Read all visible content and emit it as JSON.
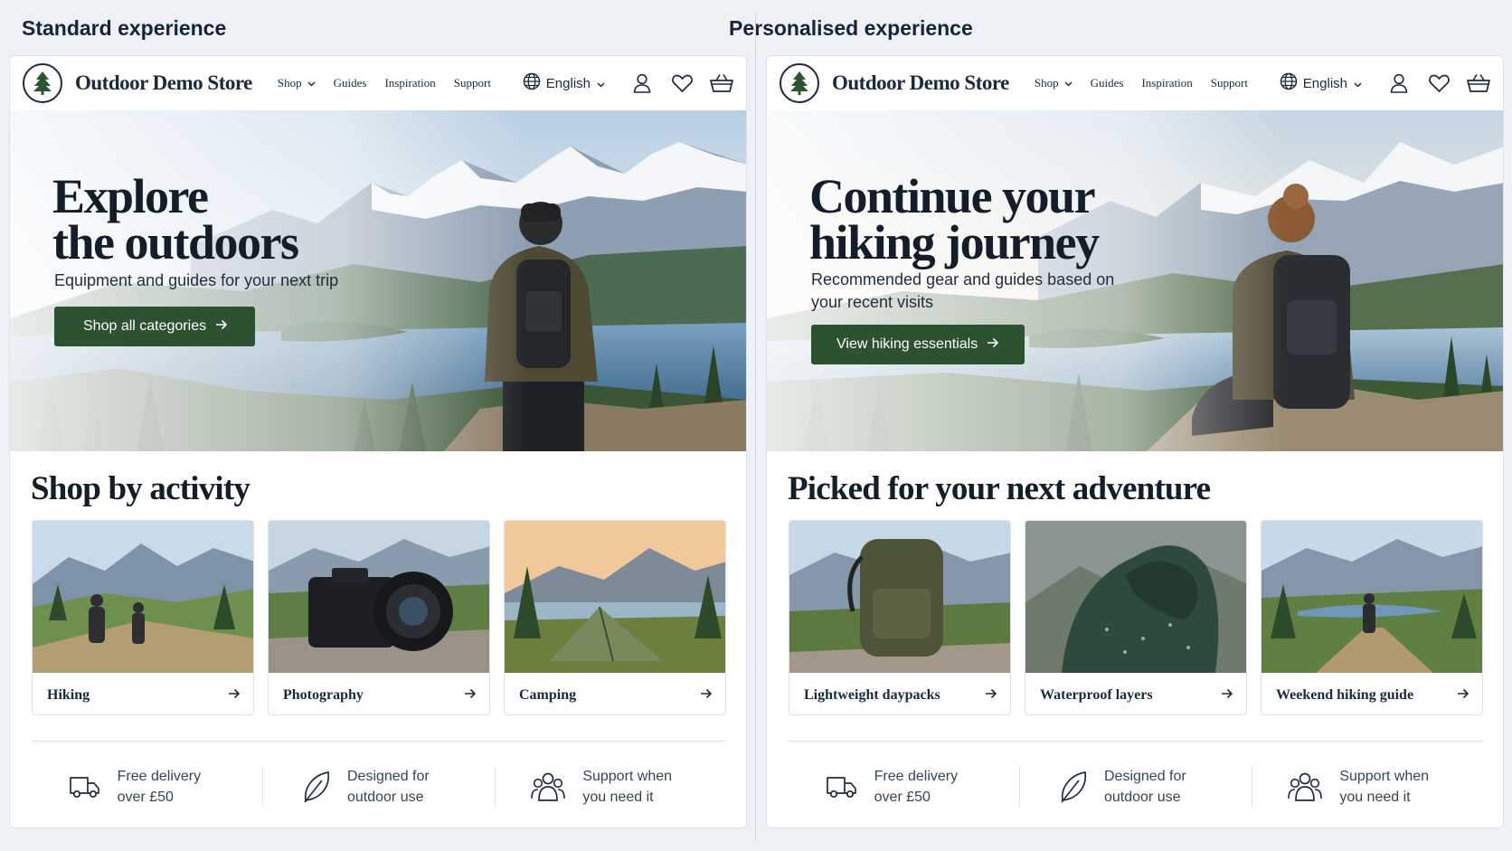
{
  "columns": {
    "left_title": "Standard experience",
    "right_title": "Personalised experience"
  },
  "header": {
    "store_name": "Outdoor Demo Store",
    "nav": [
      "Shop",
      "Guides",
      "Inspiration",
      "Support"
    ],
    "language": "English"
  },
  "standard": {
    "hero": {
      "title_line1": "Explore",
      "title_line2": "the outdoors",
      "subtitle_line1": "Equipment and guides for your next trip",
      "button": "Shop all categories"
    },
    "section_title": "Shop by activity",
    "cards": [
      "Hiking",
      "Photography",
      "Camping"
    ]
  },
  "personalised": {
    "hero": {
      "title_line1": "Continue your",
      "title_line2": "hiking journey",
      "subtitle_line1": "Recommended gear and guides based on",
      "subtitle_line2": "your recent visits",
      "button": "View hiking essentials"
    },
    "section_title": "Picked for your next adventure",
    "cards": [
      "Lightweight daypacks",
      "Waterproof layers",
      "Weekend hiking guide"
    ]
  },
  "features": [
    {
      "line1": "Free delivery",
      "line2": "over £50",
      "icon": "truck-icon"
    },
    {
      "line1": "Designed for",
      "line2": "outdoor use",
      "icon": "leaf-icon"
    },
    {
      "line1": "Support when",
      "line2": "you need it",
      "icon": "people-icon"
    }
  ],
  "colors": {
    "brand_green": "#2c5230",
    "ink": "#1b2b3d"
  }
}
